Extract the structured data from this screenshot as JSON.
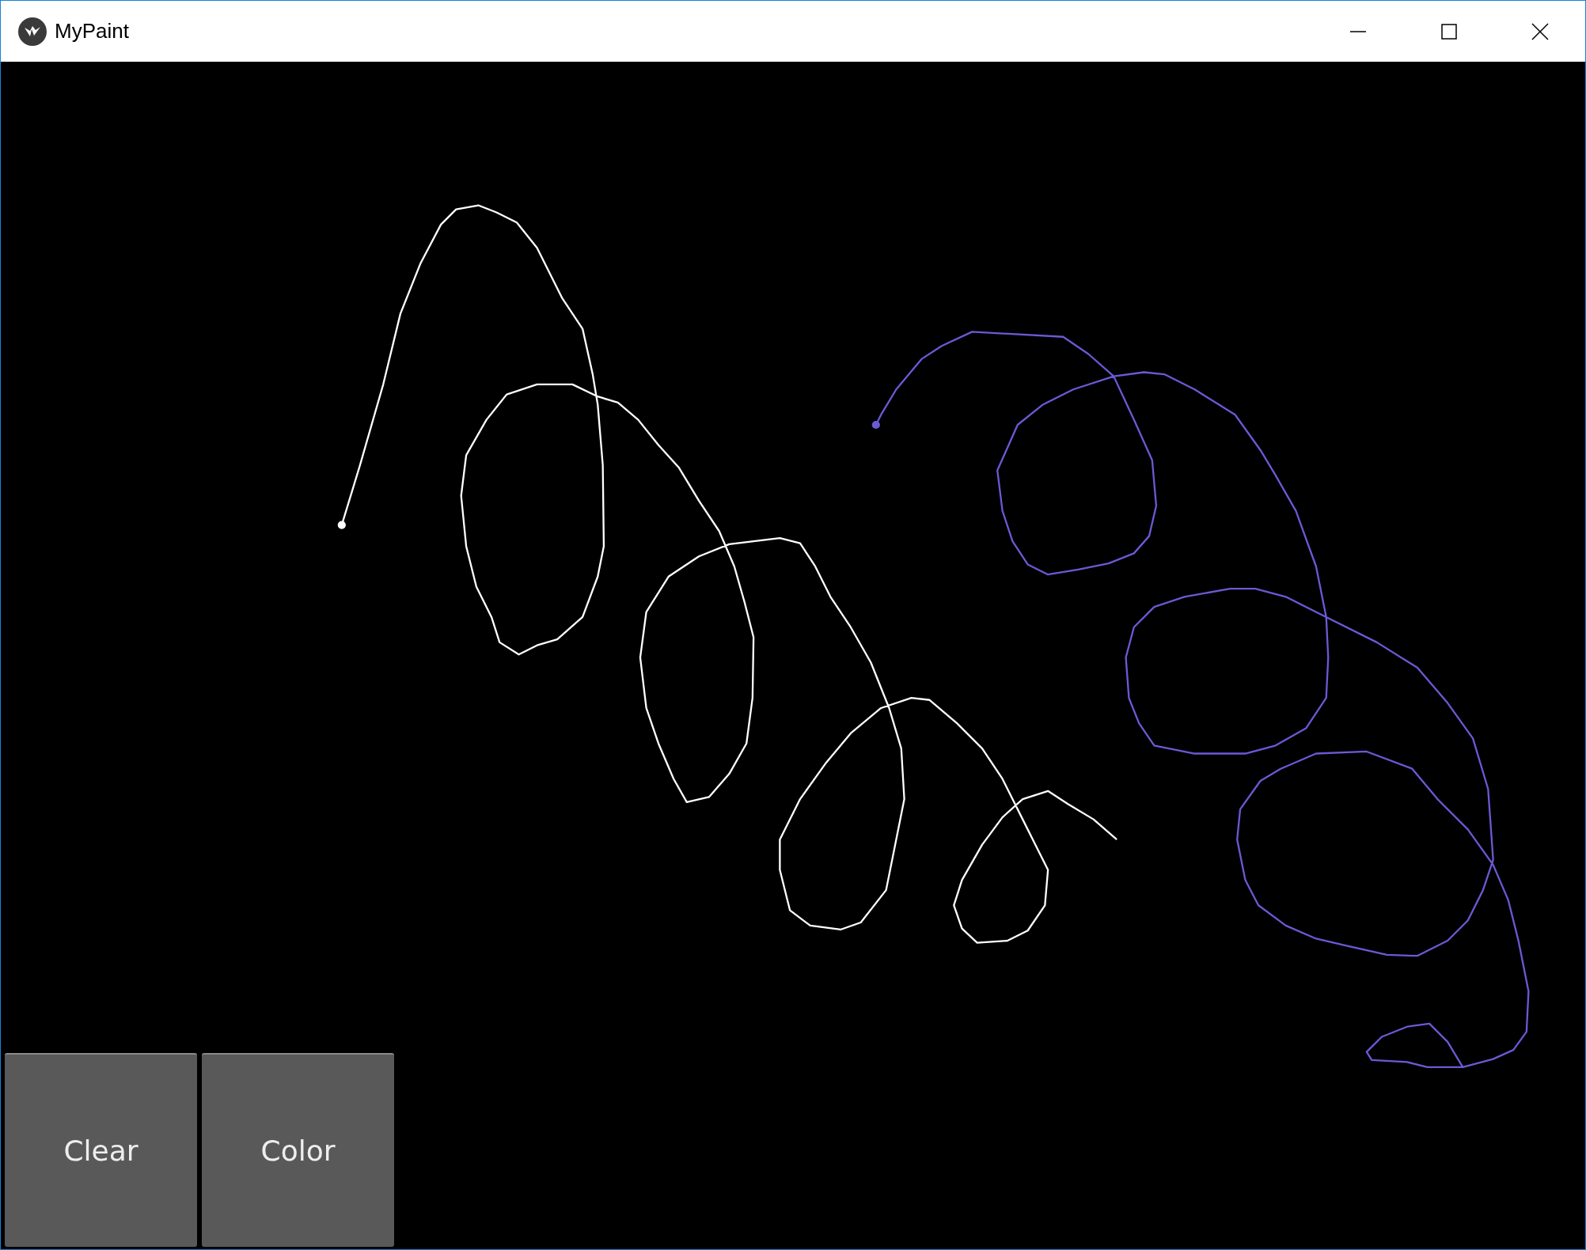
{
  "window": {
    "title": "MyPaint"
  },
  "canvas": {
    "strokes": [
      {
        "color": "#ffffff"
      },
      {
        "color": "#6a5ad6"
      }
    ]
  },
  "buttons": [
    {
      "label": "Clear"
    },
    {
      "label": "Color"
    }
  ]
}
